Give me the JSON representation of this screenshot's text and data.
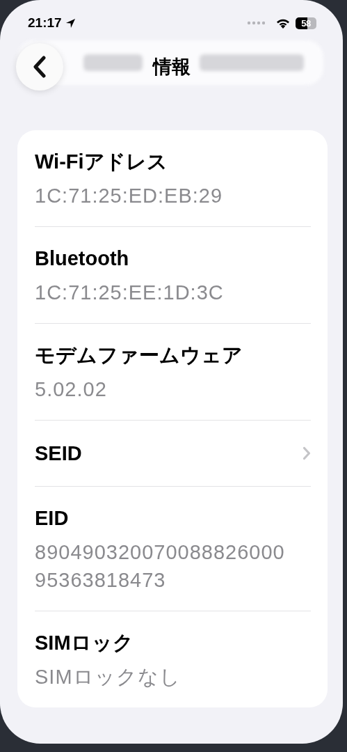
{
  "status_bar": {
    "time": "21:17",
    "battery": "58"
  },
  "nav": {
    "title": "情報"
  },
  "rows": [
    {
      "kind": "info",
      "label": "Wi-Fiアドレス",
      "value": "1C:71:25:ED:EB:29"
    },
    {
      "kind": "info",
      "label": "Bluetooth",
      "value": "1C:71:25:EE:1D:3C"
    },
    {
      "kind": "info",
      "label": "モデムファームウェア",
      "value": "5.02.02"
    },
    {
      "kind": "link",
      "label": "SEID"
    },
    {
      "kind": "info",
      "label": "EID",
      "value": "89049032007008882600095363818473"
    },
    {
      "kind": "info",
      "label": "SIMロック",
      "value": "SIMロックなし"
    }
  ]
}
